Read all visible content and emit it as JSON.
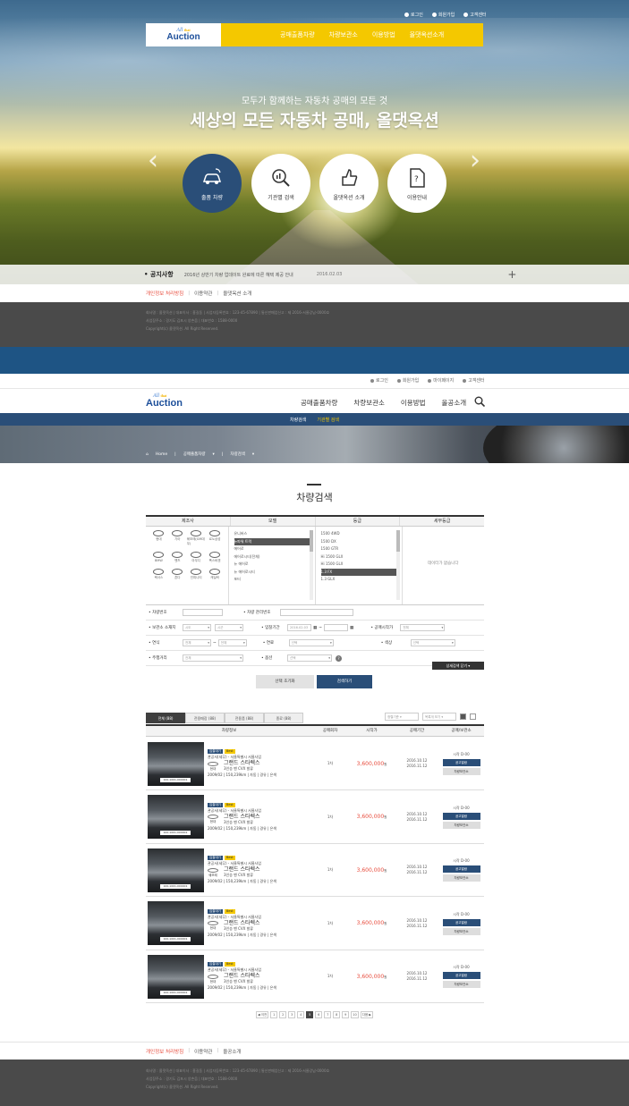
{
  "hero": {
    "util": [
      "로그인",
      "회원가입",
      "고객센터"
    ],
    "logo_top": "All",
    "logo_that": "that",
    "logo_bottom": "Auction",
    "menu": [
      "공매출품차량",
      "차량보관소",
      "이용방법",
      "올댓옥션소개"
    ],
    "subtitle": "모두가 함께하는 자동차 공매의 모든 것",
    "title": "세상의 모든 자동차 공매, 올댓옥션",
    "circles": [
      "출품 차량",
      "기관별 검색",
      "올댓옥션 소개",
      "이용안내"
    ],
    "notice_label": "공지사항",
    "notice_text": "2016년 상반기 차량 업데이트 완료에 따른 혜택 제공 안내",
    "notice_date": "2016.02.03"
  },
  "footer1": {
    "links": [
      "개인정보 처리방침",
      "이용약관",
      "올댓옥션 소개"
    ],
    "lines": [
      "회사명 : 올댓옥션 | 대표이사 : 홍길동 | 사업자등록번호 : 123-45-67890 | 통신판매업신고 : 제 2016-서울강남-0000호",
      "사업장주소 : 경기도 김포시 양촌읍 | 대표번호 : 1588-0000",
      "Copyright(c) 올댓옥션. All Right Reserved."
    ]
  },
  "page2": {
    "util": [
      "로그인",
      "회원가입",
      "마이페이지",
      "고객센터"
    ],
    "menu": [
      "공매출품차량",
      "차량보관소",
      "이용방법",
      "올공소개"
    ],
    "subnav": [
      "차량검색",
      "기관별 검색"
    ],
    "breadcrumb": [
      "Home",
      "공매출품차량",
      "차량검색"
    ],
    "page_title": "차량검색",
    "search_cols": [
      "제조사",
      "모델",
      "등급",
      "세부등급"
    ],
    "brands": [
      "현대",
      "기아",
      "쉐보레(GM대우)",
      "르노삼성",
      "BMW",
      "벤츠",
      "아우디",
      "폭스바겐",
      "렉서스",
      "혼다",
      "인피니티",
      "캐딜락"
    ],
    "models": [
      "유니버스",
      "뉴파워 트럭",
      "에어로",
      "에어로시티(전체)",
      "뉴 에어로",
      "뉴 에어로시티",
      "포터"
    ],
    "models_selected": 1,
    "grades": [
      "1500 4WD",
      "1500 DX",
      "1500 GTR",
      "Hi 1500 GLX",
      "Hi 1500 GLX",
      "1.3 FX",
      "1.3 GLX"
    ],
    "grades_selected": 5,
    "detail_empty": "데이터가 없습니다",
    "filters": {
      "car_no": "차량번호",
      "mgmt_no": "차량 관리번호",
      "storage": "보관소 소재지",
      "storage_v1": "시도",
      "storage_v2": "시군",
      "period": "입찰기간",
      "period_v": "2016.02.03",
      "seller": "공매시작가",
      "seller_v": "전체",
      "year": "연식",
      "year_v1": "전체",
      "year_v2": "전체",
      "fuel": "연료",
      "fuel_v": "선택",
      "color": "색상",
      "color_v": "선택",
      "mileage": "주행거리",
      "mileage_v": "전체",
      "option": "옵션",
      "option_v": "선택"
    },
    "adv_button": "상세검색 닫기",
    "reset_button": "선택 초기화",
    "search_button": "검색하기",
    "tabs": [
      "전체 (88)",
      "전용매장 (88)",
      "전용품 (88)",
      "종료 (88)"
    ],
    "sort1": "정렬기준",
    "sort2": "목록개 보기",
    "table_headers": [
      "차량정보",
      "공매회차",
      "시작가",
      "공매기간",
      "공매/보관소"
    ],
    "rows": [
      {
        "b1": "입찰대기",
        "b2": "Best",
        "loc": "관공서(세무) - 서울특별시 서울사업",
        "maker": "현대",
        "model": "그랜드 스타렉스",
        "sub": "3인승 밴 CVX 발류",
        "spec": "2009/02 | 150,239km | 자동 | 경유 | 은색",
        "plate": "100-1001-000001",
        "round": "1차",
        "price": "3,600,000",
        "won": "원",
        "d1": "2016.10.12",
        "d2": "2016.11.12",
        "stat": "시작 D-00",
        "btn1": "공고열람",
        "btn2": "차량보관소"
      },
      {
        "b1": "입찰대기",
        "b2": "Best",
        "loc": "관공서(세무) - 서울특별시 서울사업",
        "maker": "현대",
        "model": "그랜드 스타렉스",
        "sub": "3인승 밴 CVX 발류",
        "spec": "2009/02 | 150,239km | 자동 | 경유 | 은색",
        "plate": "100-1001-000001",
        "round": "1차",
        "price": "3,600,000",
        "won": "원",
        "d1": "2016.10.12",
        "d2": "2016.11.12",
        "stat": "시작 D-00",
        "btn1": "공고열람",
        "btn2": "차량보관소"
      },
      {
        "b1": "입찰대기",
        "b2": "Best",
        "loc": "관공서(세무) - 서울특별시 서울사업",
        "maker": "쉐보레",
        "model": "그랜드 스타렉스",
        "sub": "3인승 밴 CVX 발류",
        "spec": "2009/02 | 150,239km | 자동 | 경유 | 은색",
        "plate": "100-1001-000001",
        "round": "1차",
        "price": "3,600,000",
        "won": "원",
        "d1": "2016.10.12",
        "d2": "2016.11.12",
        "stat": "시작 D-00",
        "btn1": "공고열람",
        "btn2": "차량보관소"
      },
      {
        "b1": "입찰대기",
        "b2": "Best",
        "loc": "관공서(세무) - 서울특별시 서울사업",
        "maker": "현대",
        "model": "그랜드 스타렉스",
        "sub": "3인승 밴 CVX 발류",
        "spec": "2009/02 | 150,239km | 자동 | 경유 | 은색",
        "plate": "100-1001-000001",
        "round": "1차",
        "price": "3,600,000",
        "won": "원",
        "d1": "2016.10.12",
        "d2": "2016.11.12",
        "stat": "시작 D-00",
        "btn1": "공고열람",
        "btn2": "차량보관소"
      },
      {
        "b1": "입찰대기",
        "b2": "Best",
        "loc": "관공서(세무) - 서울특별시 서울사업",
        "maker": "현대",
        "model": "그랜드 스타렉스",
        "sub": "3인승 밴 CVX 발류",
        "spec": "2009/02 | 150,239km | 자동 | 경유 | 은색",
        "plate": "100-1001-000001",
        "round": "1차",
        "price": "3,600,000",
        "won": "원",
        "d1": "2016.10.12",
        "d2": "2016.11.12",
        "stat": "시작 D-00",
        "btn1": "공고열람",
        "btn2": "차량보관소"
      }
    ],
    "pager": {
      "prev": "◀ 이전",
      "pages": [
        "1",
        "2",
        "3",
        "4",
        "5",
        "6",
        "7",
        "8",
        "9",
        "10"
      ],
      "current": 5,
      "next": "다음 ▶"
    }
  },
  "footer2": {
    "links": [
      "개인정보 처리방침",
      "이용약관",
      "올공소개"
    ],
    "lines": [
      "회사명 : 올댓옥션 | 대표이사 : 홍길동 | 사업자등록번호 : 123-45-67890 | 통신판매업신고 : 제 2016-서울강남-0000호",
      "사업장주소 : 경기도 김포시 양촌읍 | 대표번호 : 1588-0000",
      "Copyright(c) 올댓옥션. All Right Reserved."
    ]
  },
  "colors": {
    "accent_yellow": "#f4c800",
    "navy": "#2a4e78",
    "price_red": "#e84c3d",
    "footer_gray": "#4a4a4a"
  }
}
